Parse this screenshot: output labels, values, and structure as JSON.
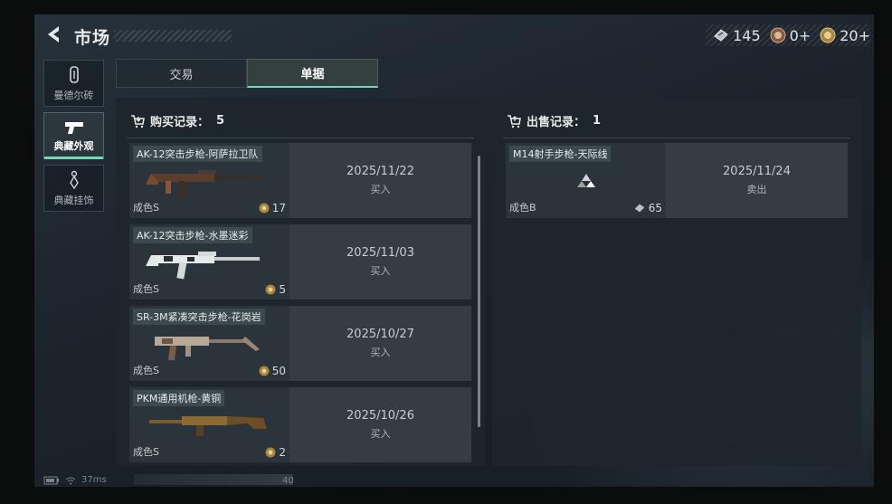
{
  "header": {
    "title": "市场",
    "currencies": [
      {
        "icon": "ticket-icon",
        "value": "145"
      },
      {
        "icon": "gold-coin-icon",
        "value": "0+"
      },
      {
        "icon": "bronze-coin-icon",
        "value": "20+"
      }
    ]
  },
  "sidebar": {
    "items": [
      {
        "label": "曼德尔砖",
        "icon": "brick-icon",
        "active": false
      },
      {
        "label": "典藏外观",
        "icon": "pistol-icon",
        "active": true
      },
      {
        "label": "典藏挂饰",
        "icon": "charm-icon",
        "active": false
      }
    ]
  },
  "tabs": [
    {
      "label": "交易",
      "active": false
    },
    {
      "label": "单据",
      "active": true
    }
  ],
  "purchase": {
    "title": "购买记录：",
    "count": "5",
    "records": [
      {
        "name": "AK-12突击步枪-阿萨拉卫队",
        "grade": "成色S",
        "price": "17",
        "date": "2025/11/22",
        "type": "买入"
      },
      {
        "name": "AK-12突击步枪-水墨迷彩",
        "grade": "成色S",
        "price": "5",
        "date": "2025/11/03",
        "type": "买入"
      },
      {
        "name": "SR-3M紧凑突击步枪-花岗岩",
        "grade": "成色S",
        "price": "50",
        "date": "2025/10/27",
        "type": "买入"
      },
      {
        "name": "PKM通用机枪-黄铜",
        "grade": "成色S",
        "price": "2",
        "date": "2025/10/26",
        "type": "买入"
      }
    ]
  },
  "sale": {
    "title": "出售记录：",
    "count": "1",
    "records": [
      {
        "name": "M14射手步枪-天际线",
        "grade": "成色B",
        "price": "65",
        "date": "2025/11/24",
        "type": "卖出"
      }
    ]
  },
  "status": {
    "ping": "37ms",
    "number": "40"
  },
  "colors": {
    "accent": "#6fd9b8",
    "background": "#1b232b",
    "card": "#333d43"
  }
}
